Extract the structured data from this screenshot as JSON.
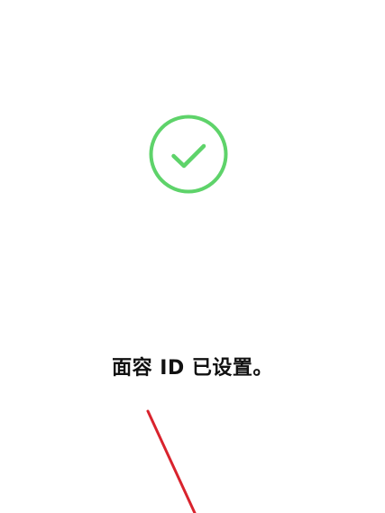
{
  "screen": {
    "status_message": "面容 ID 已设置。"
  },
  "icons": {
    "success": "checkmark-circle-icon"
  },
  "colors": {
    "background": "#ffffff",
    "success_green": "#5ED36A",
    "text": "#111111",
    "annotation_red": "#D9232D"
  }
}
